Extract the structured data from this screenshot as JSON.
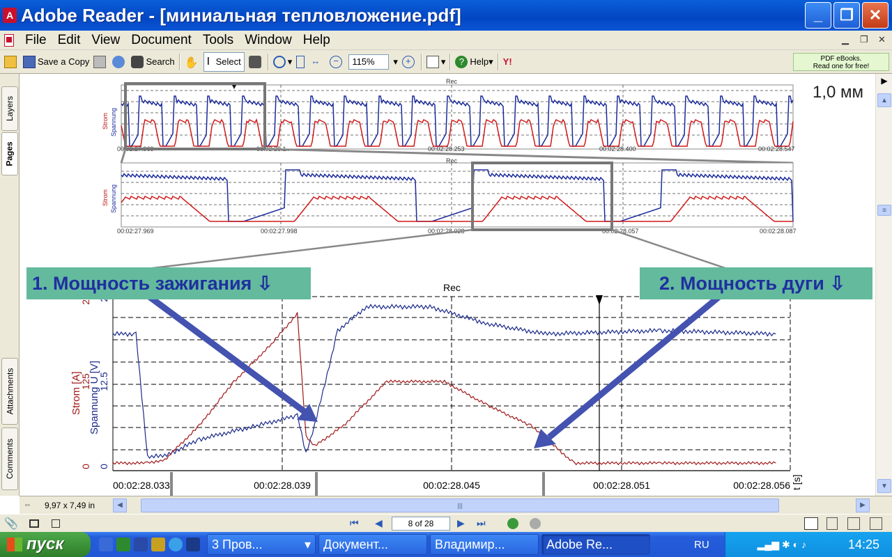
{
  "window": {
    "title": "Adobe Reader - [миниальная тепловложение.pdf]"
  },
  "menu": {
    "items": [
      "File",
      "Edit",
      "View",
      "Document",
      "Tools",
      "Window",
      "Help"
    ]
  },
  "toolbar": {
    "save_copy": "Save a Copy",
    "search": "Search",
    "select": "Select",
    "zoom": "115%",
    "help": "Help",
    "ebook_line1": "PDF eBooks.",
    "ebook_line2": "Read one for free!"
  },
  "left_tabs": {
    "layers": "Layers",
    "pages": "Pages",
    "attachments": "Attachments",
    "comments": "Comments"
  },
  "document": {
    "thickness_label": "1,0 мм",
    "callout_1": "1. Мощность зажигания ⇩",
    "callout_2": "2. Мощность дуги ⇩",
    "top_chart": {
      "rec": "Rec",
      "xticks": [
        "00:02:27.969",
        "00:02:28.1..",
        "00:02:28.253",
        "00:02:28.400",
        "00:02:28.547"
      ]
    },
    "mid_chart": {
      "rec": "Rec",
      "xticks": [
        "00:02:27.969",
        "00:02:27.998",
        "00:02:28.028",
        "00:02:28.057",
        "00:02:28.087"
      ]
    },
    "main_chart": {
      "rec": "Rec",
      "y_left_red": "Strom  [A]",
      "y_left_blue": "Spannung  U [V]",
      "xlabel": "t [s]"
    }
  },
  "chart_data": {
    "type": "line",
    "title": "",
    "xlabel": "t [s]",
    "ylabel_left": "Strom [A]",
    "ylabel_right": "Spannung U [V]",
    "x_ticks": [
      "00:02:28.033",
      "00:02:28.039",
      "00:02:28.045",
      "00:02:28.051",
      "00:02:28.056"
    ],
    "y_ticks_current": [
      0,
      125,
      250
    ],
    "y_ticks_voltage": [
      0,
      12.5,
      25
    ],
    "grid": true,
    "series": [
      {
        "name": "Strom",
        "color": "#a01818",
        "x": [
          0.033,
          0.0342,
          0.0348,
          0.036,
          0.0372,
          0.0385,
          0.0394,
          0.0397,
          0.04,
          0.041,
          0.0425,
          0.0445,
          0.046,
          0.0475,
          0.049,
          0.052,
          0.056
        ],
        "values": [
          5,
          5,
          10,
          60,
          125,
          180,
          225,
          45,
          30,
          60,
          125,
          125,
          90,
          60,
          5,
          5,
          5
        ]
      },
      {
        "name": "Spannung",
        "color": "#1a2a8a",
        "x": [
          0.033,
          0.0338,
          0.0342,
          0.0348,
          0.036,
          0.038,
          0.0394,
          0.0397,
          0.04,
          0.0408,
          0.0418,
          0.044,
          0.046,
          0.048,
          0.052,
          0.056
        ],
        "values": [
          19.5,
          19.5,
          1.5,
          1.5,
          4,
          6,
          7.5,
          2,
          6,
          20,
          23.5,
          23.5,
          21,
          19.5,
          20,
          19.5
        ]
      }
    ]
  },
  "navigation": {
    "page_indicator": "8 of 28",
    "page_size": "9,97 x 7,49 in"
  },
  "taskbar": {
    "start": "пуск",
    "tasks": [
      "3 Пров...",
      "Документ...",
      "Владимир...",
      "Adobe Re..."
    ],
    "lang": "RU",
    "clock": "14:25"
  }
}
